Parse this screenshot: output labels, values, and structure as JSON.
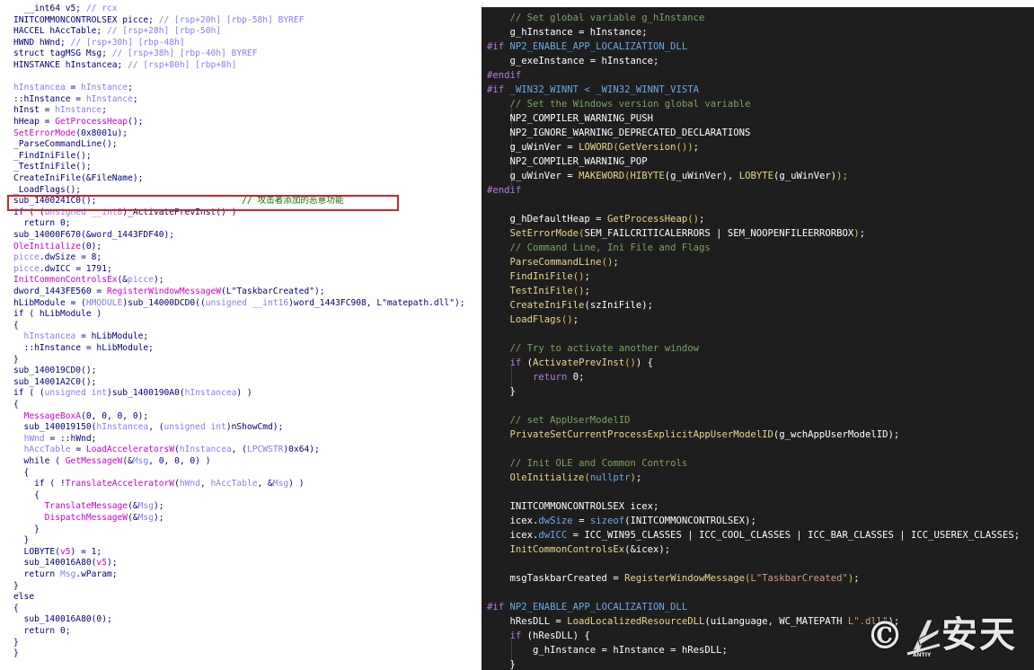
{
  "decompiled_panel": {
    "lines": [
      [
        [
          "  __int64 v5; ",
          "k"
        ],
        [
          "// rcx",
          "c"
        ]
      ],
      [
        [
          "INITCOMMONCONTROLSEX picce; ",
          "k"
        ],
        [
          "// [rsp+20h] [rbp-58h] BYREF",
          "c"
        ]
      ],
      [
        [
          "HACCEL hAccTable; ",
          "k"
        ],
        [
          "// [rsp+28h] [rbp-50h]",
          "c"
        ]
      ],
      [
        [
          "HWND hWnd; ",
          "k"
        ],
        [
          "// [rsp+30h] [rbp-48h]",
          "c"
        ]
      ],
      [
        [
          "struct tagMSG Msg; ",
          "k"
        ],
        [
          "// [rsp+38h] [rbp-40h] BYREF",
          "c"
        ]
      ],
      [
        [
          "HINSTANCE hInstancea; ",
          "k"
        ],
        [
          "// [rsp+80h] [rbp+8h]",
          "c"
        ]
      ],
      [],
      [
        [
          "hInstancea",
          "c"
        ],
        [
          " = ",
          "k"
        ],
        [
          "hInstance",
          "c"
        ],
        [
          ";",
          "k"
        ]
      ],
      [
        [
          "::hInstance = ",
          "k"
        ],
        [
          "hInstance",
          "c"
        ],
        [
          ";",
          "k"
        ]
      ],
      [
        [
          "hInst = ",
          "k"
        ],
        [
          "hInstance",
          "c"
        ],
        [
          ";",
          "k"
        ]
      ],
      [
        [
          "hHeap = ",
          "k"
        ],
        [
          "GetProcessHeap",
          "f"
        ],
        [
          "();",
          "k"
        ]
      ],
      [
        [
          "SetErrorMode",
          "f"
        ],
        [
          "(0x8001u);",
          "k"
        ]
      ],
      [
        [
          "_ParseCommandLine();",
          "k"
        ]
      ],
      [
        [
          "_FindIniFile();",
          "k"
        ]
      ],
      [
        [
          "_TestIniFile();",
          "k"
        ]
      ],
      [
        [
          "CreateIniFile(&FileName);",
          "k"
        ]
      ],
      [
        [
          "_LoadFlags();",
          "k"
        ]
      ],
      [
        [
          "sub_1400241C0();",
          "k"
        ],
        [
          "                            // 攻击者添加的恶意功能",
          "cn"
        ]
      ],
      [
        [
          "if ( (",
          "k"
        ],
        [
          "unsigned __int8",
          "c"
        ],
        [
          ")_ActivatePrevInst() )",
          "k"
        ]
      ],
      [
        [
          "  return 0;",
          "k"
        ]
      ],
      [
        [
          "sub_14000F670(&word_1443FDF40);",
          "k"
        ]
      ],
      [
        [
          "OleInitialize",
          "f"
        ],
        [
          "(0);",
          "k"
        ]
      ],
      [
        [
          "picce",
          "c"
        ],
        [
          ".dwSize = 8;",
          "k"
        ]
      ],
      [
        [
          "picce",
          "c"
        ],
        [
          ".dwICC = 1791;",
          "k"
        ]
      ],
      [
        [
          "InitCommonControlsEx",
          "f"
        ],
        [
          "(&",
          "k"
        ],
        [
          "picce",
          "c"
        ],
        [
          ");",
          "k"
        ]
      ],
      [
        [
          "dword_1443FE560 = ",
          "k"
        ],
        [
          "RegisterWindowMessageW",
          "f"
        ],
        [
          "(L\"TaskbarCreated\");",
          "k"
        ]
      ],
      [
        [
          "hLibModule = (",
          "k"
        ],
        [
          "HMODULE",
          "c"
        ],
        [
          ")sub_14000DCD0((",
          "k"
        ],
        [
          "unsigned __int16",
          "c"
        ],
        [
          ")word_1443FC908, L\"matepath.dll\");",
          "k"
        ]
      ],
      [
        [
          "if ( hLibModule )",
          "k"
        ]
      ],
      [
        [
          "{",
          "k"
        ]
      ],
      [
        [
          "  hInstancea",
          "c"
        ],
        [
          " = hLibModule;",
          "k"
        ]
      ],
      [
        [
          "  ::hInstance = hLibModule;",
          "k"
        ]
      ],
      [
        [
          "}",
          "k"
        ]
      ],
      [
        [
          "sub_140019CD0();",
          "k"
        ]
      ],
      [
        [
          "sub_14001A2C0();",
          "k"
        ]
      ],
      [
        [
          "if ( (",
          "k"
        ],
        [
          "unsigned int",
          "c"
        ],
        [
          ")sub_1400190A0(",
          "k"
        ],
        [
          "hInstancea",
          "c"
        ],
        [
          ") )",
          "k"
        ]
      ],
      [
        [
          "{",
          "k"
        ]
      ],
      [
        [
          "  MessageBoxA",
          "f"
        ],
        [
          "(0, 0, 0, 0);",
          "k"
        ]
      ],
      [
        [
          "  sub_140019150(",
          "k"
        ],
        [
          "hInstancea",
          "c"
        ],
        [
          ", (",
          "k"
        ],
        [
          "unsigned int",
          "c"
        ],
        [
          ")nShowCmd);",
          "k"
        ]
      ],
      [
        [
          "  ",
          "k"
        ],
        [
          "hWnd",
          "c"
        ],
        [
          " = ::hWnd;",
          "k"
        ]
      ],
      [
        [
          "  ",
          "k"
        ],
        [
          "hAccTable",
          "c"
        ],
        [
          " = ",
          "k"
        ],
        [
          "LoadAcceleratorsW",
          "f"
        ],
        [
          "(",
          "k"
        ],
        [
          "hInstancea",
          "c"
        ],
        [
          ", (",
          "k"
        ],
        [
          "LPCWSTR",
          "c"
        ],
        [
          ")0x64);",
          "k"
        ]
      ],
      [
        [
          "  while ( ",
          "k"
        ],
        [
          "GetMessageW",
          "f"
        ],
        [
          "(&",
          "k"
        ],
        [
          "Msg",
          "c"
        ],
        [
          ", 0, 0, 0) )",
          "k"
        ]
      ],
      [
        [
          "  {",
          "k"
        ]
      ],
      [
        [
          "    if ( !",
          "k"
        ],
        [
          "TranslateAcceleratorW",
          "f"
        ],
        [
          "(",
          "k"
        ],
        [
          "hWnd",
          "c"
        ],
        [
          ", ",
          "k"
        ],
        [
          "hAccTable",
          "c"
        ],
        [
          ", &",
          "k"
        ],
        [
          "Msg",
          "c"
        ],
        [
          ") )",
          "k"
        ]
      ],
      [
        [
          "    {",
          "k"
        ]
      ],
      [
        [
          "      TranslateMessage",
          "f"
        ],
        [
          "(&",
          "k"
        ],
        [
          "Msg",
          "c"
        ],
        [
          ");",
          "k"
        ]
      ],
      [
        [
          "      DispatchMessageW",
          "f"
        ],
        [
          "(&",
          "k"
        ],
        [
          "Msg",
          "c"
        ],
        [
          ");",
          "k"
        ]
      ],
      [
        [
          "    }",
          "k"
        ]
      ],
      [
        [
          "  }",
          "k"
        ]
      ],
      [
        [
          "  LOBYTE(",
          "k"
        ],
        [
          "v5",
          "f"
        ],
        [
          ") = 1;",
          "k"
        ]
      ],
      [
        [
          "  sub_140016A80(",
          "k"
        ],
        [
          "v5",
          "f"
        ],
        [
          ");",
          "k"
        ]
      ],
      [
        [
          "  return ",
          "k"
        ],
        [
          "Msg",
          "c"
        ],
        [
          ".wParam;",
          "k"
        ]
      ],
      [
        [
          "}",
          "k"
        ]
      ],
      [
        [
          "else",
          "k"
        ]
      ],
      [
        [
          "{",
          "k"
        ]
      ],
      [
        [
          "  sub_140016A80(0);",
          "k"
        ]
      ],
      [
        [
          "  return 0;",
          "k"
        ]
      ],
      [
        [
          "}",
          "k"
        ]
      ],
      [
        [
          "}",
          "k"
        ]
      ]
    ]
  },
  "source_panel": {
    "lines": [
      [
        [
          "    ",
          "n"
        ],
        [
          "// Set global variable g_hInstance",
          "c"
        ]
      ],
      [
        [
          "    g_hInstance = hInstance;",
          "n"
        ]
      ],
      [
        [
          "#if ",
          "pp"
        ],
        [
          "NP2_ENABLE_APP_LOCALIZATION_DLL",
          "m"
        ]
      ],
      [
        [
          "    g_exeInstance = hInstance;",
          "n"
        ]
      ],
      [
        [
          "#endif",
          "pp"
        ]
      ],
      [
        [
          "#if ",
          "pp"
        ],
        [
          "_WIN32_WINNT < _WIN32_WINNT_VISTA",
          "m"
        ]
      ],
      [
        [
          "    ",
          "n"
        ],
        [
          "// Set the Windows version global variable",
          "c"
        ]
      ],
      [
        [
          "    NP2_COMPILER_WARNING_PUSH",
          "n"
        ]
      ],
      [
        [
          "    NP2_IGNORE_WARNING_DEPRECATED_DECLARATIONS",
          "n"
        ]
      ],
      [
        [
          "    g_uWinVer = ",
          "n"
        ],
        [
          "LOWORD",
          "f"
        ],
        [
          "(",
          "b"
        ],
        [
          "GetVersion",
          "f"
        ],
        [
          "())",
          "b"
        ],
        [
          ";",
          "n"
        ]
      ],
      [
        [
          "    NP2_COMPILER_WARNING_POP",
          "n"
        ]
      ],
      [
        [
          "    g_uWinVer = ",
          "n"
        ],
        [
          "MAKEWORD",
          "f"
        ],
        [
          "(",
          "b"
        ],
        [
          "HIBYTE",
          "f"
        ],
        [
          "(g_uWinVer), ",
          "n"
        ],
        [
          "LOBYTE",
          "f"
        ],
        [
          "(g_uWinVer)",
          "n"
        ],
        [
          ");",
          "b"
        ]
      ],
      [
        [
          "#endif",
          "pp"
        ]
      ],
      [],
      [
        [
          "    g_hDefaultHeap = ",
          "n"
        ],
        [
          "GetProcessHeap",
          "f"
        ],
        [
          "()",
          "b"
        ],
        [
          ";",
          "n"
        ]
      ],
      [
        [
          "    ",
          "n"
        ],
        [
          "SetErrorMode",
          "f"
        ],
        [
          "(",
          "b"
        ],
        [
          "SEM_FAILCRITICALERRORS | SEM_NOOPENFILEERRORBOX",
          "n"
        ],
        [
          ")",
          "b"
        ],
        [
          ";",
          "n"
        ]
      ],
      [
        [
          "    ",
          "n"
        ],
        [
          "// Command Line, Ini File and Flags",
          "c"
        ]
      ],
      [
        [
          "    ",
          "n"
        ],
        [
          "ParseCommandLine",
          "f"
        ],
        [
          "()",
          "b"
        ],
        [
          ";",
          "n"
        ]
      ],
      [
        [
          "    ",
          "n"
        ],
        [
          "FindIniFile",
          "f"
        ],
        [
          "()",
          "b"
        ],
        [
          ";",
          "n"
        ]
      ],
      [
        [
          "    ",
          "n"
        ],
        [
          "TestIniFile",
          "f"
        ],
        [
          "()",
          "b"
        ],
        [
          ";",
          "n"
        ]
      ],
      [
        [
          "    ",
          "n"
        ],
        [
          "CreateIniFile",
          "f"
        ],
        [
          "(szIniFile)",
          "n"
        ],
        [
          ";",
          "n"
        ]
      ],
      [
        [
          "    ",
          "n"
        ],
        [
          "LoadFlags",
          "f"
        ],
        [
          "()",
          "b"
        ],
        [
          ";",
          "n"
        ]
      ],
      [],
      [
        [
          "    ",
          "n"
        ],
        [
          "// Try to activate another window",
          "c"
        ]
      ],
      [
        [
          "    ",
          "n"
        ],
        [
          "if",
          "pp"
        ],
        [
          " (",
          "n"
        ],
        [
          "ActivatePrevInst",
          "f"
        ],
        [
          "()",
          "b"
        ],
        [
          ") {",
          "n"
        ]
      ],
      [
        [
          "        ",
          "n"
        ],
        [
          "return",
          "pp"
        ],
        [
          " 0;",
          "n"
        ]
      ],
      [
        [
          "    }",
          "n"
        ]
      ],
      [],
      [
        [
          "    ",
          "n"
        ],
        [
          "// set AppUserModelID",
          "c"
        ]
      ],
      [
        [
          "    ",
          "n"
        ],
        [
          "PrivateSetCurrentProcessExplicitAppUserModelID",
          "f"
        ],
        [
          "(g_wchAppUserModelID)",
          "n"
        ],
        [
          ";",
          "n"
        ]
      ],
      [],
      [
        [
          "    ",
          "n"
        ],
        [
          "// Init OLE and Common Controls",
          "c"
        ]
      ],
      [
        [
          "    ",
          "n"
        ],
        [
          "OleInitialize",
          "f"
        ],
        [
          "(",
          "b"
        ],
        [
          "nullptr",
          "m"
        ],
        [
          ")",
          "b"
        ],
        [
          ";",
          "n"
        ]
      ],
      [],
      [
        [
          "    INITCOMMONCONTROLSEX icex;",
          "n"
        ]
      ],
      [
        [
          "    icex.",
          "n"
        ],
        [
          "dwSize",
          "m"
        ],
        [
          " = ",
          "n"
        ],
        [
          "sizeof",
          "m"
        ],
        [
          "(INITCOMMONCONTROLSEX)",
          "n"
        ],
        [
          ";",
          "n"
        ]
      ],
      [
        [
          "    icex.",
          "n"
        ],
        [
          "dwICC",
          "m"
        ],
        [
          " = ICC_WIN95_CLASSES | ICC_COOL_CLASSES | ICC_BAR_CLASSES | ICC_USEREX_CLASSES;",
          "n"
        ]
      ],
      [
        [
          "    ",
          "n"
        ],
        [
          "InitCommonControlsEx",
          "f"
        ],
        [
          "(&icex)",
          "n"
        ],
        [
          ";",
          "n"
        ]
      ],
      [],
      [
        [
          "    msgTaskbarCreated = ",
          "n"
        ],
        [
          "RegisterWindowMessage",
          "f"
        ],
        [
          "(",
          "b"
        ],
        [
          "L\"TaskbarCreated\"",
          "s"
        ],
        [
          ")",
          "b"
        ],
        [
          ";",
          "n"
        ]
      ],
      [],
      [
        [
          "#if ",
          "pp"
        ],
        [
          "NP2_ENABLE_APP_LOCALIZATION_DLL",
          "m"
        ]
      ],
      [
        [
          "    hResDLL = ",
          "n"
        ],
        [
          "LoadLocalizedResourceDLL",
          "f"
        ],
        [
          "(uiLanguage, WC_MATEPATH ",
          "n"
        ],
        [
          "L\".dll\"",
          "s"
        ],
        [
          ");",
          "n"
        ]
      ],
      [
        [
          "    ",
          "n"
        ],
        [
          "if",
          "pp"
        ],
        [
          " (hResDLL) {",
          "n"
        ]
      ],
      [
        [
          "        g_hInstance = hInstance = hResDLL;",
          "n"
        ]
      ],
      [
        [
          "    }",
          "n"
        ]
      ]
    ]
  },
  "watermark": {
    "symbol": "©",
    "brand_cn": "安天",
    "brand_en": "ANTIY"
  },
  "colors": {
    "highlight_border": "#d0242a",
    "dark_background": "#1e1e1e"
  }
}
